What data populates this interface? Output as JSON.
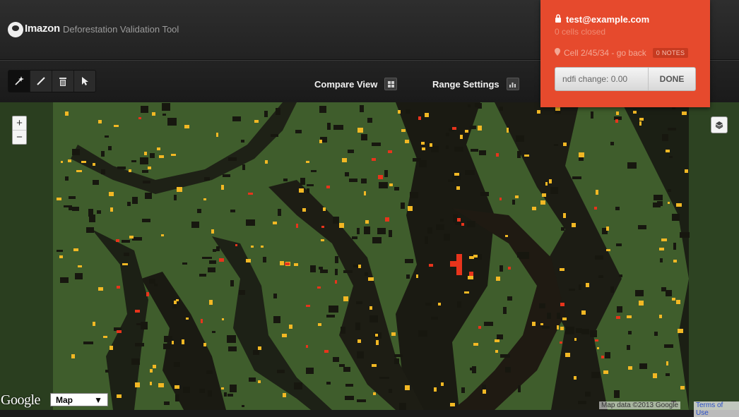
{
  "header": {
    "logo_text": "Imazon",
    "app_title": "Deforestation Validation Tool"
  },
  "toolbar": {
    "tools": [
      {
        "name": "magic-wand",
        "glyph": "✶"
      },
      {
        "name": "pencil",
        "glyph": "✎"
      },
      {
        "name": "trash",
        "glyph": "🗑"
      },
      {
        "name": "pointer",
        "glyph": "➤"
      }
    ],
    "compare_view": "Compare View",
    "range_settings": "Range Settings"
  },
  "account": {
    "email": "test@example.com",
    "cells_closed": "0 cells closed",
    "cell_label": "Cell 2/45/34 - go back",
    "notes_badge": "0 NOTES",
    "ndfi_change": "ndfi change: 0.00",
    "done": "DONE",
    "accent_color": "#e64a2d"
  },
  "map": {
    "zoom_in": "+",
    "zoom_out": "−",
    "maptype": "Map",
    "attribution": "Map data ©2013 Google",
    "terms": "Terms of Use",
    "google_logo": "Google"
  }
}
